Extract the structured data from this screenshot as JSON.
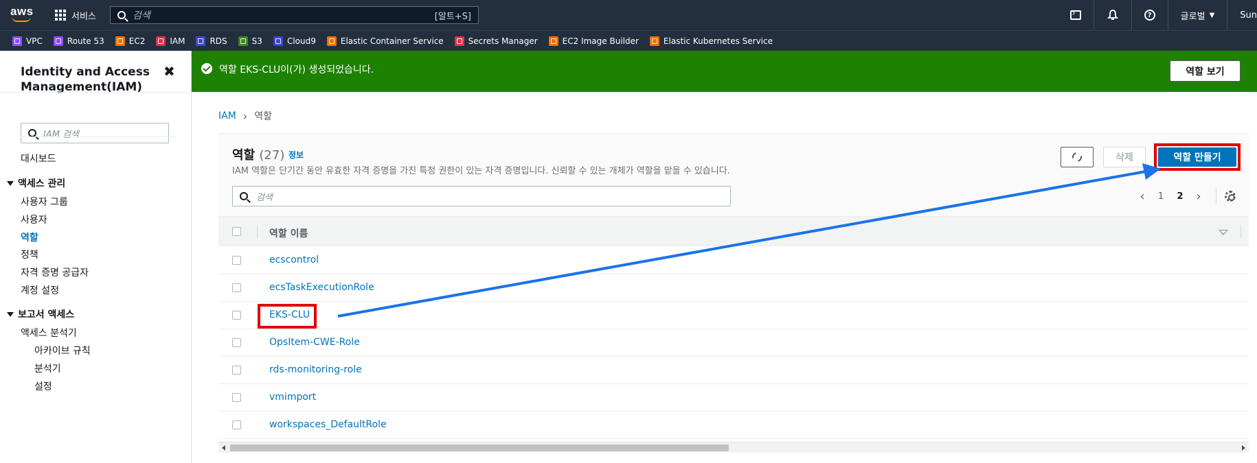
{
  "topnav": {
    "logo": "aws",
    "services": "서비스",
    "search_placeholder": "검색",
    "search_shortcut": "[알트+S]",
    "region": "글로벌",
    "account": "Sun"
  },
  "favorites": [
    {
      "label": "VPC",
      "color": "#8c4fff"
    },
    {
      "label": "Route 53",
      "color": "#8c4fff"
    },
    {
      "label": "EC2",
      "color": "#ed7100"
    },
    {
      "label": "IAM",
      "color": "#dd344c"
    },
    {
      "label": "RDS",
      "color": "#3b48cc"
    },
    {
      "label": "S3",
      "color": "#3f8624"
    },
    {
      "label": "Cloud9",
      "color": "#3b48cc"
    },
    {
      "label": "Elastic Container Service",
      "color": "#ed7100"
    },
    {
      "label": "Secrets Manager",
      "color": "#dd344c"
    },
    {
      "label": "EC2 Image Builder",
      "color": "#ed7100"
    },
    {
      "label": "Elastic Kubernetes Service",
      "color": "#ed7100"
    }
  ],
  "sidebar": {
    "title": "Identity and Access Management(IAM)",
    "close": "✖",
    "search_placeholder": "IAM 검색",
    "dashboard": "대시보드",
    "access_mgmt": {
      "label": "액세스 관리",
      "items": [
        "사용자 그룹",
        "사용자",
        "역할",
        "정책",
        "자격 증명 공급자",
        "계정 설정"
      ]
    },
    "reports": {
      "label": "보고서 액세스",
      "analyzer": "액세스 분석기",
      "sub_items": [
        "아카이브 규칙",
        "분석기",
        "설정"
      ]
    }
  },
  "flash": {
    "message": "역할 EKS-CLU이(가) 생성되었습니다.",
    "button": "역할 보기"
  },
  "breadcrumb": {
    "root": "IAM",
    "current": "역할"
  },
  "panel": {
    "title": "역할",
    "count": "(27)",
    "info": "정보",
    "description": "IAM 역할은 단기간 동안 유효한 자격 증명을 가진 특정 권한이 있는 자격 증명입니다. 신뢰할 수 있는 개체가 역할을 맡을 수 있습니다.",
    "delete": "삭제",
    "create": "역할 만들기",
    "search_placeholder": "검색",
    "pages": [
      "1",
      "2"
    ],
    "column_header": "역할 이름",
    "rows": [
      "ecscontrol",
      "ecsTaskExecutionRole",
      "EKS-CLU",
      "OpsItem-CWE-Role",
      "rds-monitoring-role",
      "vmimport",
      "workspaces_DefaultRole"
    ]
  },
  "colors": {
    "navy": "#232f3e",
    "success": "#1d8102",
    "link": "#0073bb",
    "highlight": "#e00000",
    "arrow": "#1a73e8"
  }
}
